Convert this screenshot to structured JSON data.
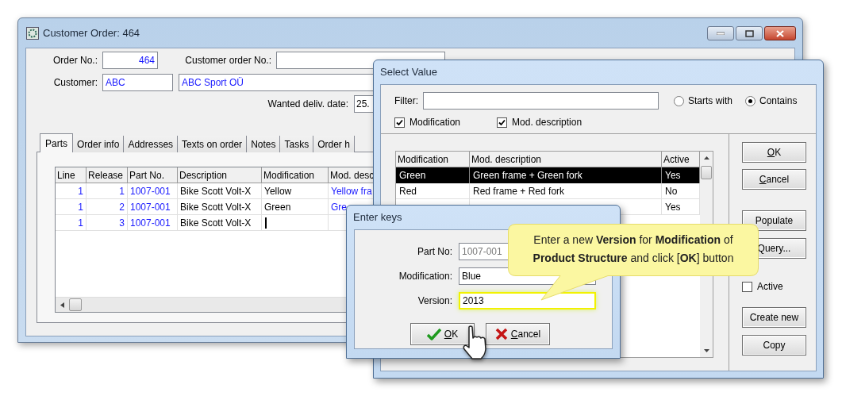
{
  "main_window": {
    "title": "Customer Order: 464",
    "form": {
      "order_no_label": "Order No.:",
      "order_no": "464",
      "customer_order_no_label": "Customer order No.:",
      "customer_label": "Customer:",
      "customer_code": "ABC",
      "customer_name": "ABC Sport OÜ",
      "wanted_date_label": "Wanted deliv. date:",
      "wanted_date": "25."
    },
    "tabs": [
      {
        "label": "Parts",
        "selected": true
      },
      {
        "label": "Order info",
        "selected": false
      },
      {
        "label": "Addresses",
        "selected": false
      },
      {
        "label": "Texts on order",
        "selected": false
      },
      {
        "label": "Notes",
        "selected": false
      },
      {
        "label": "Tasks",
        "selected": false
      },
      {
        "label": "Order h",
        "selected": false
      }
    ],
    "parts_table": {
      "columns": [
        "Line",
        "Release",
        "Part No.",
        "Description",
        "Modification",
        "Mod. desc"
      ],
      "rows": [
        {
          "line": "1",
          "release": "1",
          "part_no": "1007-001",
          "description": "Bike Scott Volt-X",
          "modification": "Yellow",
          "mod_description": "Yellow fra",
          "editing": false
        },
        {
          "line": "1",
          "release": "2",
          "part_no": "1007-001",
          "description": "Bike Scott Volt-X",
          "modification": "Green",
          "mod_description": "Gre",
          "editing": false
        },
        {
          "line": "1",
          "release": "3",
          "part_no": "1007-001",
          "description": "Bike Scott Volt-X",
          "editing": true
        }
      ]
    }
  },
  "select_value": {
    "title": "Select Value",
    "filter_label": "Filter:",
    "match_options": [
      {
        "label": "Starts with",
        "selected": false
      },
      {
        "label": "Contains",
        "selected": true
      }
    ],
    "search_in": [
      {
        "label": "Modification",
        "checked": true
      },
      {
        "label": "Mod. description",
        "checked": true
      }
    ],
    "table": {
      "columns": [
        "Modification",
        "Mod. description",
        "Active"
      ],
      "rows": [
        {
          "modification": "Green",
          "mod_description": "Green frame + Green fork",
          "active": "Yes",
          "selected": true
        },
        {
          "modification": "Red",
          "mod_description": "Red frame + Red fork",
          "active": "No",
          "selected": false
        },
        {
          "active": "Yes",
          "selected": false
        }
      ]
    },
    "buttons_top": [
      {
        "label": "OK",
        "underline_first": true
      },
      {
        "label": "Cancel",
        "underline_first": true
      }
    ],
    "buttons_middle": [
      {
        "label": "Populate"
      },
      {
        "label": "Query..."
      }
    ],
    "active_filter": {
      "label": "Active",
      "checked": false
    },
    "buttons_bottom": [
      {
        "label": "Create new"
      },
      {
        "label": "Copy"
      }
    ]
  },
  "enter_keys": {
    "title": "Enter keys",
    "fields": [
      {
        "label": "Part No:",
        "value": "1007-001",
        "disabled": true,
        "highlighted": false
      },
      {
        "label": "Modification:",
        "value": "Blue",
        "disabled": false,
        "highlighted": false
      },
      {
        "label": "Version:",
        "value": "2013",
        "disabled": false,
        "highlighted": true
      }
    ],
    "buttons": [
      {
        "label": "OK",
        "kind": "ok"
      },
      {
        "label": "Cancel",
        "kind": "cancel"
      }
    ]
  },
  "callout": {
    "text": "Enter a new **Version** for **Modification** of **Product Structure** and click [**OK**] button"
  }
}
